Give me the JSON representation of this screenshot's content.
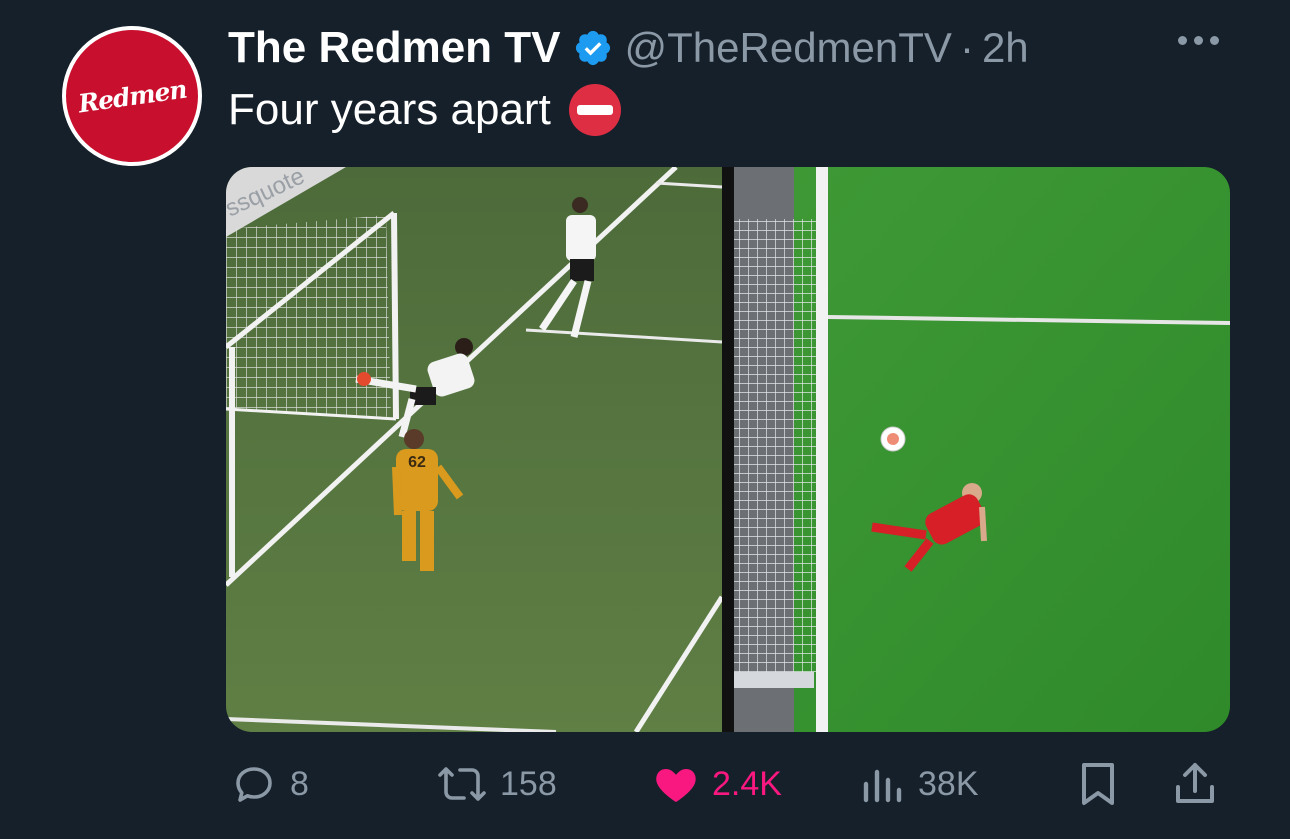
{
  "tweet": {
    "author": {
      "display_name": "The Redmen TV",
      "handle": "@TheRedmenTV",
      "separator": "·",
      "time": "2h",
      "avatar_text": "Redmen",
      "verified": true
    },
    "text": "Four years apart",
    "emoji": "no-entry-icon",
    "media": {
      "left_image": {
        "shirt_number": "62"
      },
      "right_image": {}
    },
    "actions": {
      "replies": "8",
      "retweets": "158",
      "likes": "2.4K",
      "views": "38K"
    }
  },
  "colors": {
    "background": "#15202b",
    "text_primary": "#ffffff",
    "text_secondary": "#8b98a5",
    "verified_blue": "#1d9bf0",
    "like_pink": "#f91880",
    "avatar_red": "#c8102e"
  }
}
